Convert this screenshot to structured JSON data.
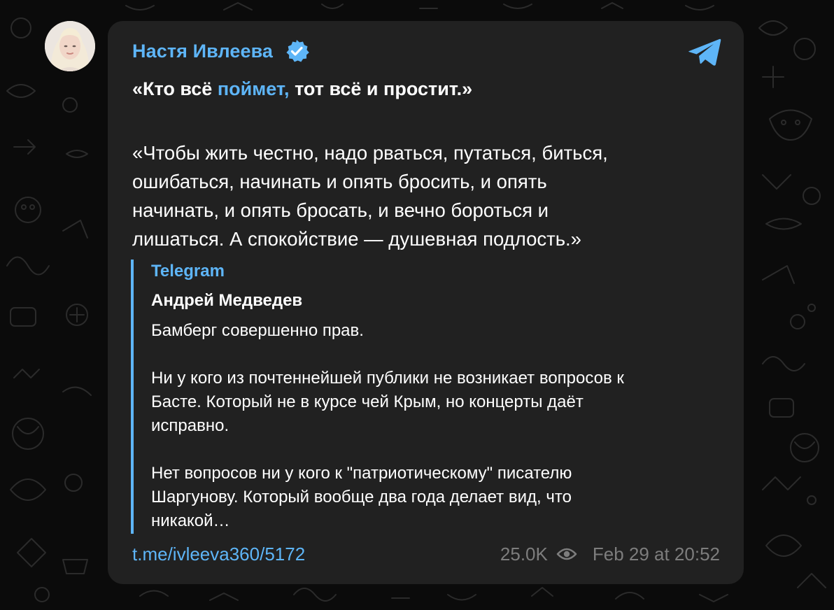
{
  "post": {
    "author": "Настя Ивлеева",
    "headline_before": "«Кто всё ",
    "headline_link": "поймет,",
    "headline_after": " тот всё и простит.»",
    "quote_lines": [
      "«Чтобы жить честно, надо рваться, путаться, биться,",
      "ошибаться, начинать и опять бросить, и опять",
      "начинать, и опять бросать, и вечно бороться и",
      "лишаться. А спокойствие — душевная подлость.»"
    ],
    "reply": {
      "source": "Telegram",
      "author": "Андрей Медведев",
      "lines": [
        "Бамберг совершенно прав.",
        "",
        "Ни у кого из почтеннейшей публики не возникает вопросов к",
        "Басте. Который не в курсе чей Крым, но концерты даёт",
        "исправно.",
        "",
        "Нет вопросов ни у кого к \"патриотическому\" писателю",
        "Шаргунову. Который вообще два года делает вид, что",
        "никакой…"
      ]
    },
    "link": "t.me/ivleeva360/5172",
    "views": "25.0K",
    "date": "Feb 29 at 20:52"
  },
  "colors": {
    "accent": "#5eb5f7",
    "card": "#212121",
    "background": "#0b0b0b",
    "muted": "#7d7d7d",
    "text": "#ffffff"
  },
  "icons": {
    "verified": "verified-badge-icon",
    "channel": "telegram-logo-icon",
    "views": "eye-icon",
    "avatar": "author-avatar"
  }
}
